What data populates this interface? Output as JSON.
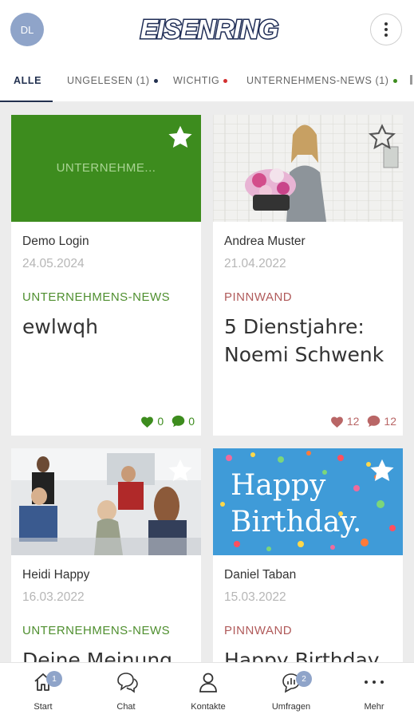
{
  "header": {
    "avatar_initials": "DL",
    "logo_text": "EISENRING"
  },
  "tabs": [
    {
      "label": "ALLE",
      "active": true
    },
    {
      "label": "UNGELESEN (1)",
      "dot_color": "#22304f"
    },
    {
      "label": "WICHTIG",
      "dot_color": "#d32f2f"
    },
    {
      "label": "UNTERNEHMENS-NEWS (1)",
      "dot_color": "#3d8c1e"
    }
  ],
  "cards": [
    {
      "image_text": "UNTERNEHME...",
      "author": "Demo Login",
      "date": "24.05.2024",
      "category": "UNTERNEHMENS-NEWS",
      "category_color": "#4f8f2f",
      "title": "ewlwqh",
      "likes": "0",
      "comments": "0",
      "reaction_color": "#3d8c1e"
    },
    {
      "author": "Andrea Muster",
      "date": "21.04.2022",
      "category": "PINNWAND",
      "category_color": "#b05a5a",
      "title": "5 Dienstjahre: Noemi Schwenk",
      "likes": "12",
      "comments": "12",
      "reaction_color": "#b96666"
    },
    {
      "author": "Heidi Happy",
      "date": "16.03.2022",
      "category": "UNTERNEHMENS-NEWS",
      "category_color": "#4f8f2f",
      "title": "Deine Meinung"
    },
    {
      "image_text_1": "Happy",
      "image_text_2": "Birthday.",
      "author": "Daniel Taban",
      "date": "15.03.2022",
      "category": "PINNWAND",
      "category_color": "#b05a5a",
      "title": "Happy Birthday"
    }
  ],
  "bottom_nav": [
    {
      "label": "Start",
      "icon": "home-icon",
      "badge": "1"
    },
    {
      "label": "Chat",
      "icon": "chat-icon"
    },
    {
      "label": "Kontakte",
      "icon": "person-icon"
    },
    {
      "label": "Umfragen",
      "icon": "poll-icon",
      "badge": "2"
    },
    {
      "label": "Mehr",
      "icon": "more-horizontal-icon"
    }
  ]
}
